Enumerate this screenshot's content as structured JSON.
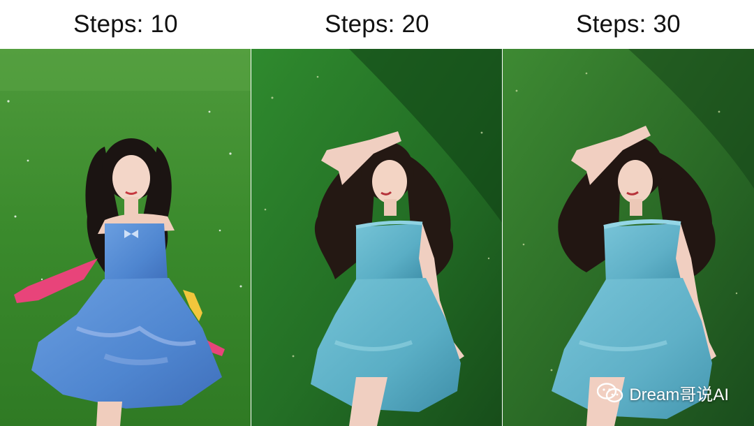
{
  "labels": [
    {
      "text": "Steps: 10"
    },
    {
      "text": "Steps: 20"
    },
    {
      "text": "Steps: 30"
    }
  ],
  "watermark": {
    "text": "Dream哥说AI",
    "icon": "wechat-icon"
  },
  "colors": {
    "grass_light": "#3f8d2f",
    "grass_dark": "#1f5a20",
    "dress_blue": "#5b8fd6",
    "dress_teal": "#5fb3c9",
    "sleeve_pink": "#e8447a",
    "hair": "#1b1412",
    "skin": "#f2d2c2"
  }
}
